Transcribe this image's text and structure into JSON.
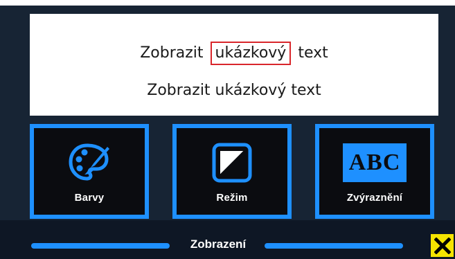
{
  "preview": {
    "line1_before": "Zobrazit",
    "line1_highlight": "ukázkový",
    "line1_after": "text",
    "line2": "Zobrazit ukázkový text"
  },
  "tiles": [
    {
      "label": "Barvy",
      "icon": "palette-icon"
    },
    {
      "label": "Režim",
      "icon": "contrast-mode-icon"
    },
    {
      "label": "Zvýraznění",
      "icon": "abc-highlight-icon",
      "icon_text": "ABC"
    }
  ],
  "footer": {
    "title": "Zobrazení",
    "close_icon": "close-icon"
  },
  "colors": {
    "accent": "#1e90ff",
    "highlight_border": "#d9262b",
    "close_bg": "#f5e400",
    "tile_bg": "#0b0c10"
  }
}
